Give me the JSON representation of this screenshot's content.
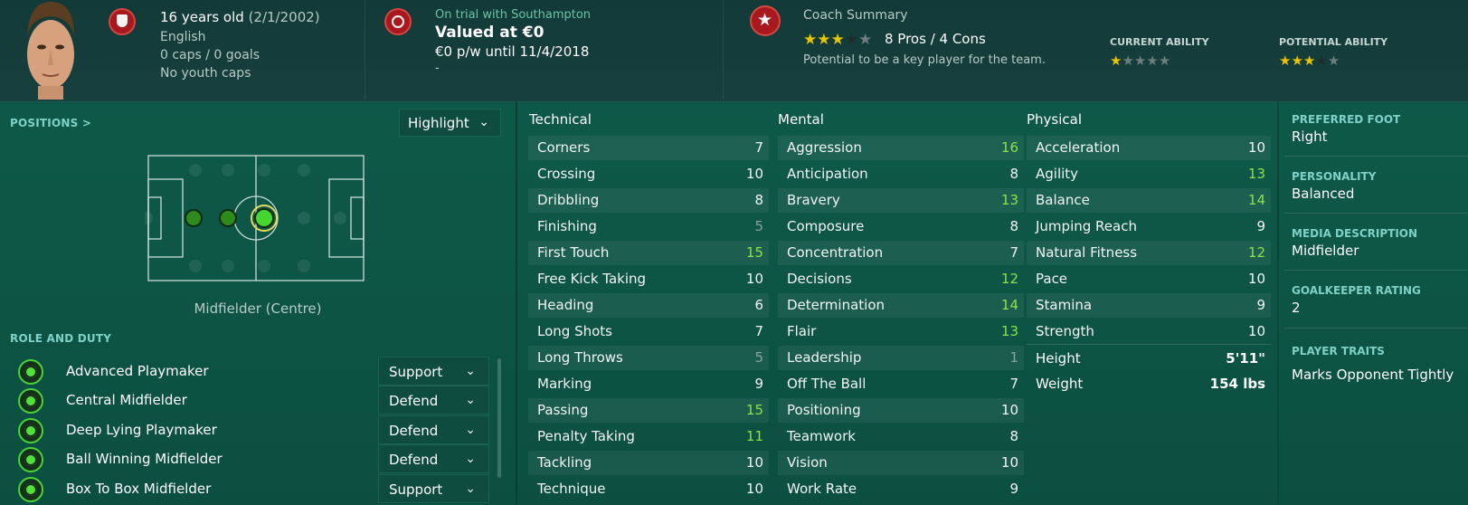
{
  "header": {
    "age": "16 years old",
    "dob": "(2/1/2002)",
    "nationality": "English",
    "caps": "0 caps / 0 goals",
    "youth_caps": "No youth caps",
    "trial": "On trial with Southampton",
    "valued": "Valued at €0",
    "wage": "€0 p/w until 11/4/2018",
    "dash": "-",
    "coach_title": "Coach Summary",
    "pros_cons": "8 Pros / 4 Cons",
    "coach_note": "Potential to be a key player for the team.",
    "current_ability_label": "CURRENT ABILITY",
    "potential_ability_label": "POTENTIAL ABILITY",
    "coach_stars": 3,
    "current_ability_stars": 1,
    "potential_ability_stars": 3,
    "colors": {
      "star_on": "#e8c300",
      "badge_red": "#a8191f",
      "high_value": "#8fe04a"
    }
  },
  "positions": {
    "link": "POSITIONS >",
    "highlight_label": "Highlight",
    "position_label": "Midfielder (Centre)"
  },
  "roles": {
    "title": "ROLE AND DUTY",
    "items": [
      {
        "name": "Advanced Playmaker",
        "duty": "Support"
      },
      {
        "name": "Central Midfielder",
        "duty": "Defend"
      },
      {
        "name": "Deep Lying Playmaker",
        "duty": "Defend"
      },
      {
        "name": "Ball Winning Midfielder",
        "duty": "Defend"
      },
      {
        "name": "Box To Box Midfielder",
        "duty": "Support"
      }
    ]
  },
  "attributes": {
    "technical": {
      "title": "Technical",
      "items": [
        {
          "name": "Corners",
          "value": "7",
          "tone": "normal"
        },
        {
          "name": "Crossing",
          "value": "10",
          "tone": "normal"
        },
        {
          "name": "Dribbling",
          "value": "8",
          "tone": "normal"
        },
        {
          "name": "Finishing",
          "value": "5",
          "tone": "low"
        },
        {
          "name": "First Touch",
          "value": "15",
          "tone": "high"
        },
        {
          "name": "Free Kick Taking",
          "value": "10",
          "tone": "normal"
        },
        {
          "name": "Heading",
          "value": "6",
          "tone": "normal"
        },
        {
          "name": "Long Shots",
          "value": "7",
          "tone": "normal"
        },
        {
          "name": "Long Throws",
          "value": "5",
          "tone": "low"
        },
        {
          "name": "Marking",
          "value": "9",
          "tone": "normal"
        },
        {
          "name": "Passing",
          "value": "15",
          "tone": "high"
        },
        {
          "name": "Penalty Taking",
          "value": "11",
          "tone": "high"
        },
        {
          "name": "Tackling",
          "value": "10",
          "tone": "normal"
        },
        {
          "name": "Technique",
          "value": "10",
          "tone": "normal"
        }
      ]
    },
    "mental": {
      "title": "Mental",
      "items": [
        {
          "name": "Aggression",
          "value": "16",
          "tone": "high"
        },
        {
          "name": "Anticipation",
          "value": "8",
          "tone": "normal"
        },
        {
          "name": "Bravery",
          "value": "13",
          "tone": "high"
        },
        {
          "name": "Composure",
          "value": "8",
          "tone": "normal"
        },
        {
          "name": "Concentration",
          "value": "7",
          "tone": "normal"
        },
        {
          "name": "Decisions",
          "value": "12",
          "tone": "high"
        },
        {
          "name": "Determination",
          "value": "14",
          "tone": "high"
        },
        {
          "name": "Flair",
          "value": "13",
          "tone": "high"
        },
        {
          "name": "Leadership",
          "value": "1",
          "tone": "low"
        },
        {
          "name": "Off The Ball",
          "value": "7",
          "tone": "normal"
        },
        {
          "name": "Positioning",
          "value": "10",
          "tone": "normal"
        },
        {
          "name": "Teamwork",
          "value": "8",
          "tone": "normal"
        },
        {
          "name": "Vision",
          "value": "10",
          "tone": "normal"
        },
        {
          "name": "Work Rate",
          "value": "9",
          "tone": "normal"
        }
      ]
    },
    "physical": {
      "title": "Physical",
      "items": [
        {
          "name": "Acceleration",
          "value": "10",
          "tone": "normal"
        },
        {
          "name": "Agility",
          "value": "13",
          "tone": "high"
        },
        {
          "name": "Balance",
          "value": "14",
          "tone": "high"
        },
        {
          "name": "Jumping Reach",
          "value": "9",
          "tone": "normal"
        },
        {
          "name": "Natural Fitness",
          "value": "12",
          "tone": "high"
        },
        {
          "name": "Pace",
          "value": "10",
          "tone": "normal"
        },
        {
          "name": "Stamina",
          "value": "9",
          "tone": "normal"
        },
        {
          "name": "Strength",
          "value": "10",
          "tone": "normal"
        }
      ],
      "height_label": "Height",
      "height_value": "5'11\"",
      "weight_label": "Weight",
      "weight_value": "154 lbs"
    }
  },
  "profile": {
    "preferred_foot_label": "PREFERRED FOOT",
    "preferred_foot": "Right",
    "personality_label": "PERSONALITY",
    "personality": "Balanced",
    "media_label": "MEDIA DESCRIPTION",
    "media": "Midfielder",
    "gk_label": "GOALKEEPER RATING",
    "gk": "2",
    "traits_label": "PLAYER TRAITS",
    "trait": "Marks Opponent Tightly"
  }
}
